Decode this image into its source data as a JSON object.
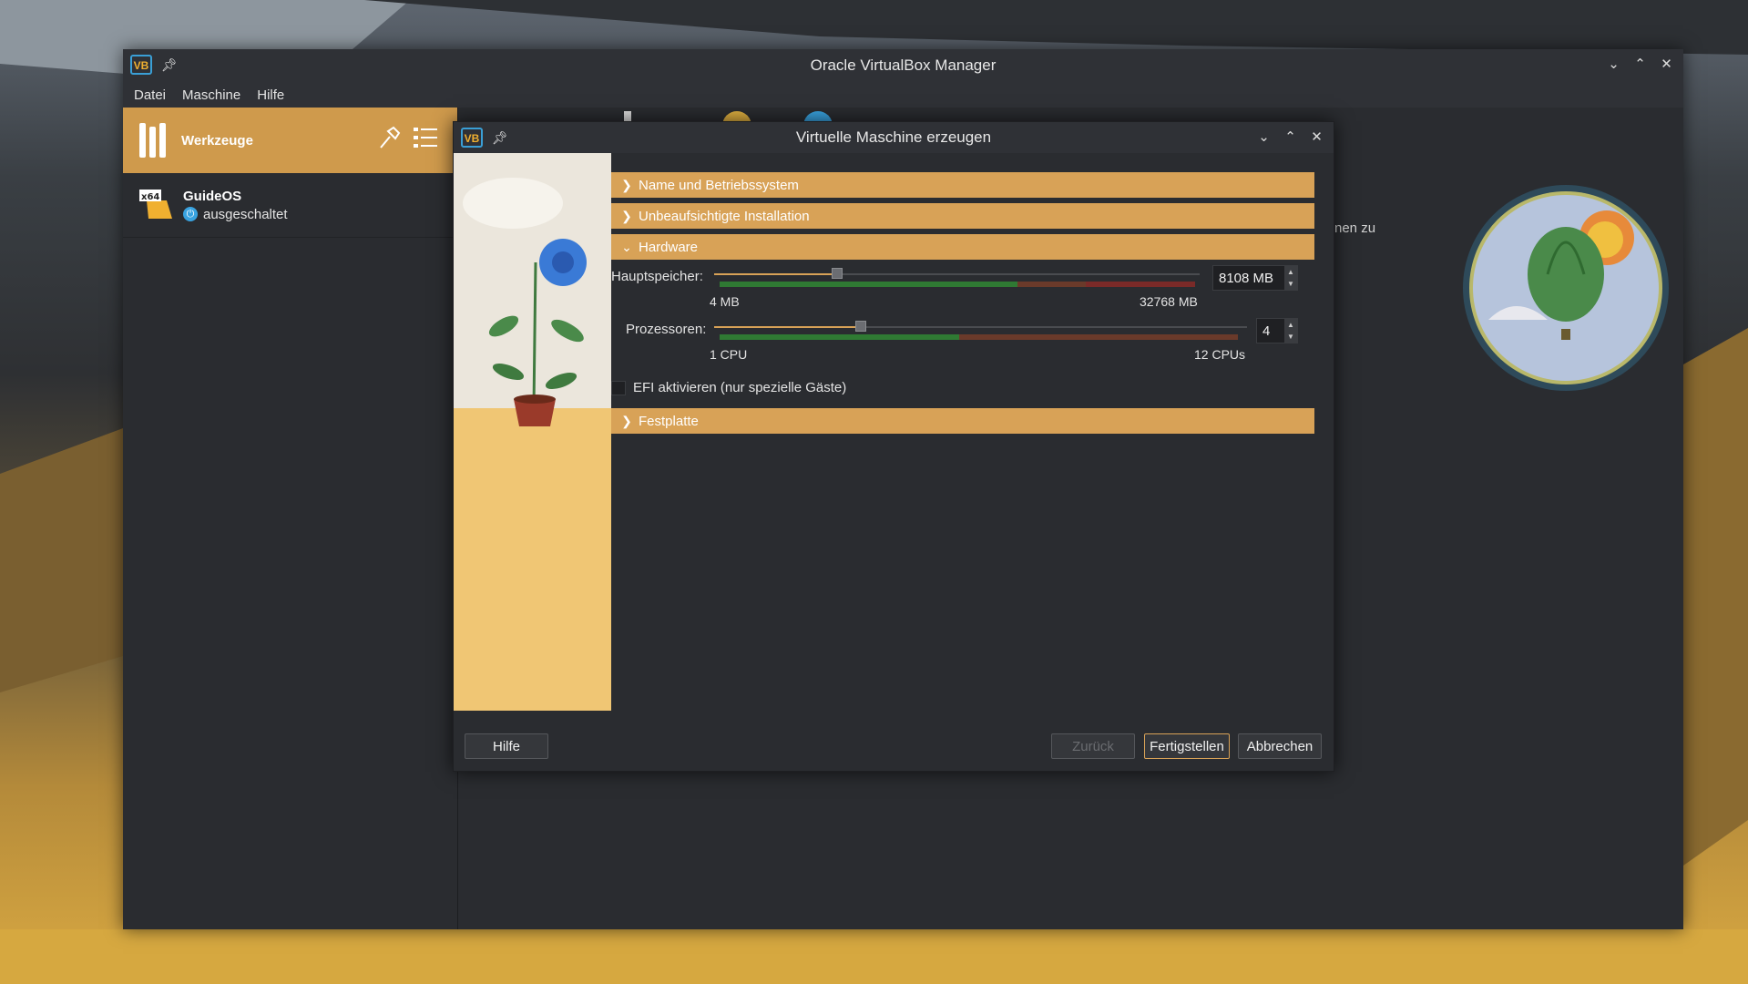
{
  "manager": {
    "title": "Oracle VirtualBox Manager",
    "menu": [
      "Datei",
      "Maschine",
      "Hilfe"
    ],
    "tools_label": "Werkzeuge",
    "vm": {
      "name": "GuideOS",
      "state": "ausgeschaltet",
      "badge": "x64"
    },
    "right_text": "nen zu"
  },
  "dialog": {
    "title": "Virtuelle Maschine erzeugen",
    "sections": {
      "name": "Name und Betriebssystem",
      "unattended": "Unbeaufsichtigte Installation",
      "hardware": "Hardware",
      "disk": "Festplatte"
    },
    "memory": {
      "label": "Hauptspeicher:",
      "value": "8108 MB",
      "min": "4 MB",
      "max": "32768 MB",
      "fraction": 0.247
    },
    "cpu": {
      "label": "Prozessoren:",
      "value": "4",
      "min": "1 CPU",
      "max": "12 CPUs",
      "fraction": 0.273
    },
    "efi": {
      "label": "EFI aktivieren (nur spezielle Gäste)",
      "checked": false
    },
    "buttons": {
      "help": "Hilfe",
      "back": "Zurück",
      "finish": "Fertigstellen",
      "cancel": "Abbrechen"
    }
  },
  "colors": {
    "accent": "#d8a257",
    "tools_bar": "#cf9a4c",
    "side_panel": "#f0c674"
  }
}
